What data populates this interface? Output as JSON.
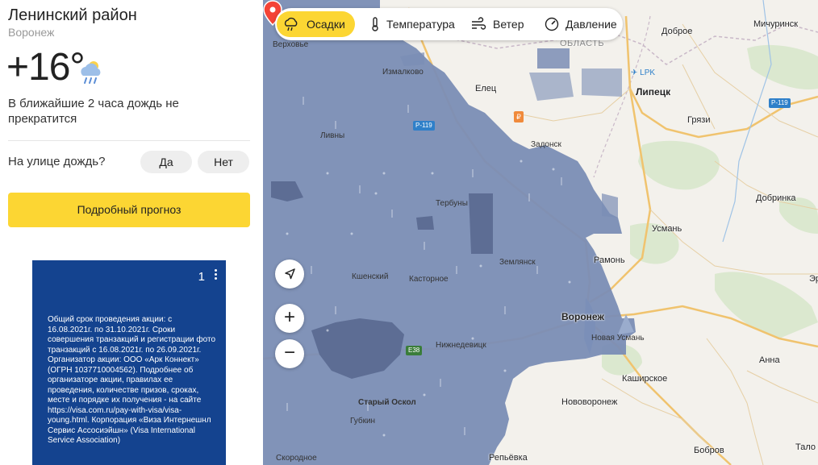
{
  "location": {
    "title": "Ленинский район",
    "subtitle": "Воронеж"
  },
  "weather": {
    "temperature": "+16°",
    "icon": "rain-cloud-icon",
    "nowcast": "В ближайшие 2 часа дождь не прекратится"
  },
  "poll": {
    "question": "На улице дождь?",
    "yes": "Да",
    "no": "Нет"
  },
  "forecast_button": "Подробный прогноз",
  "ad": {
    "counter": "1",
    "text": "Общий срок проведения акции: с 16.08.2021г. по 31.10.2021г. Сроки совершения транзакций и регистрации фото транзакций с 16.08.2021г. по 26.09.2021г. Организатор акции: ООО «Арк Коннект» (ОГРН 1037710004562). Подробнее об организаторе акции, правилах ее проведения, количестве призов, сроках, месте и порядке их получения - на сайте https://visa.com.ru/pay-with-visa/visa-young.html. Корпорация «Виза Интернешнл Сервис Ассосиэйшн» (Visa International Service Association)",
    "background": "#14438f"
  },
  "layer_tabs": [
    {
      "label": "Осадки",
      "icon": "precipitation-icon",
      "active": true
    },
    {
      "label": "Температура",
      "icon": "thermometer-icon",
      "active": false
    },
    {
      "label": "Ветер",
      "icon": "wind-icon",
      "active": false
    },
    {
      "label": "Давление",
      "icon": "pressure-gauge-icon",
      "active": false
    }
  ],
  "map": {
    "labels": {
      "verkhovye": "Верховье",
      "izmalkovo": "Измалково",
      "oblast": "ОБЛАСТЬ",
      "dobroe": "Доброе",
      "michurinsk": "Мичуринск",
      "elets": "Елец",
      "lipetsk": "Липецк",
      "gryazi": "Грязи",
      "livny": "Ливны",
      "zadonsk": "Задонск",
      "terbuny": "Тербуны",
      "dobrinka": "Добринка",
      "usman": "Усмань",
      "zemlyansk": "Землянск",
      "ramon": "Рамонь",
      "kshensky": "Кшенский",
      "kastornoye": "Касторное",
      "voronezh": "Воронеж",
      "novaya_usman": "Новая Усмань",
      "nizhnedevitsk": "Нижнедевицк",
      "stary_oskol": "Старый Оскол",
      "kashirskoye": "Каширское",
      "anna": "Анна",
      "gubkin": "Губкин",
      "novovoronezh": "Нововоронеж",
      "skorodnoe": "Скородное",
      "repyovka": "Репьёвка",
      "bobrov": "Бобров",
      "talovaya": "Тало",
      "er": "Эр"
    },
    "roads": {
      "p119_top": "Р-119",
      "p119_right": "Р-119",
      "e38": "E38"
    },
    "airport": "LPK",
    "marker_icon": "location-pin-icon",
    "precipitation_color": "#7a8db5"
  },
  "controls": {
    "locate_icon": "navigation-arrow-icon",
    "zoom_in": "+",
    "zoom_out": "−"
  }
}
